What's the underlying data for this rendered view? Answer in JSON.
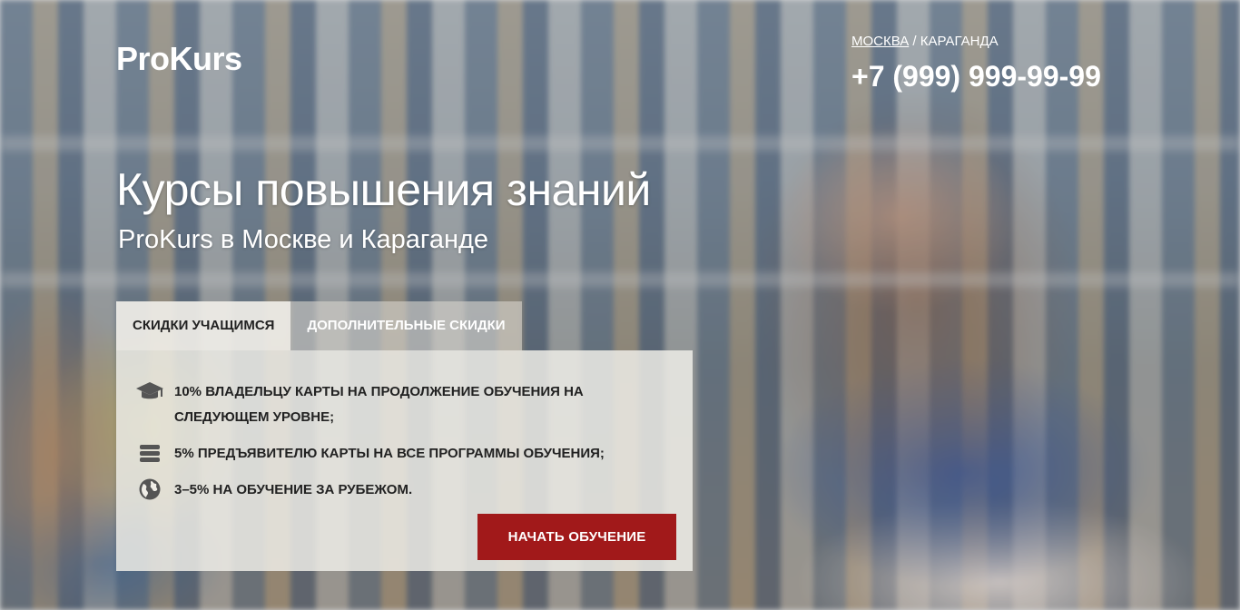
{
  "header": {
    "logo": "ProKurs",
    "city_active": "МОСКВА",
    "city_separator": " / ",
    "city_other": "КАРАГАНДА",
    "phone": "+7 (999) 999-99-99"
  },
  "hero": {
    "title": "Курсы повышения знаний",
    "subtitle": "ProKurs в Москве и Караганде"
  },
  "tabs": [
    {
      "label": "СКИДКИ УЧАЩИМСЯ",
      "active": true
    },
    {
      "label": "ДОПОЛНИТЕЛЬНЫЕ СКИДКИ",
      "active": false
    }
  ],
  "discounts": {
    "items": [
      {
        "icon": "graduation-cap-icon",
        "text": "10% владельцу карты на продолжение обучения на следующем уровне;"
      },
      {
        "icon": "stack-icon",
        "text": "5% предъявителю карты на все программы обучения;"
      },
      {
        "icon": "globe-icon",
        "text": "3–5% на обучение за рубежом."
      }
    ],
    "cta_label": "НАЧАТЬ ОБУЧЕНИЕ"
  },
  "colors": {
    "accent": "#a1191a",
    "panel": "#f0eee8",
    "icon": "#555555"
  }
}
